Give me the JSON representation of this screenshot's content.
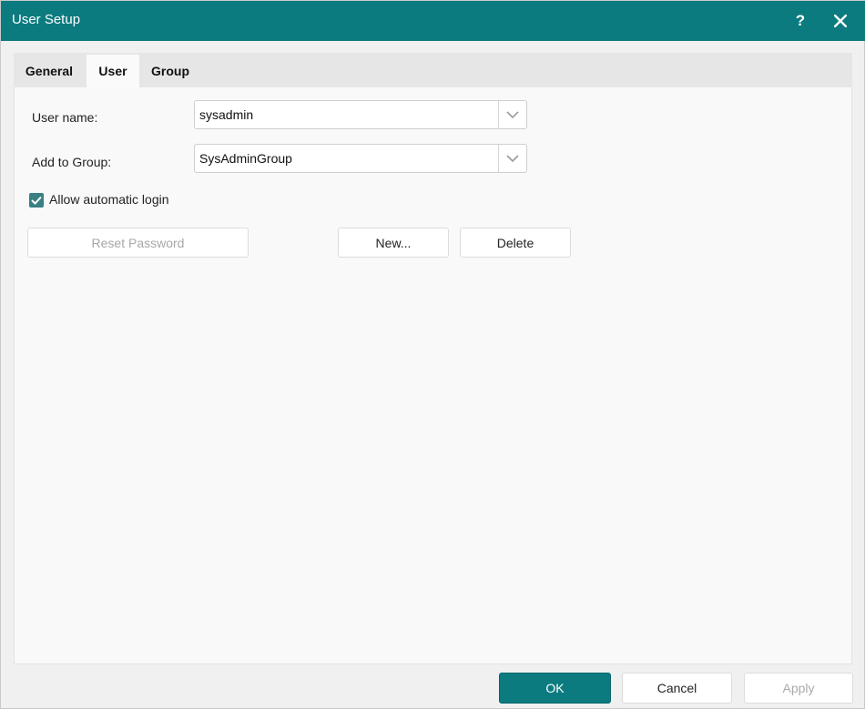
{
  "window": {
    "title": "User Setup",
    "help_icon": "question-mark-icon",
    "close_icon": "close-icon",
    "accent_color": "#0b7b7f"
  },
  "tabs": [
    {
      "label": "General",
      "active": false
    },
    {
      "label": "User",
      "active": true
    },
    {
      "label": "Group",
      "active": false
    }
  ],
  "form": {
    "user_name_label": "User name:",
    "user_name_value": "sysadmin",
    "group_label": "Add to Group:",
    "group_value": "SysAdminGroup",
    "auto_login_label": "Allow automatic login",
    "auto_login_checked": true
  },
  "actions": {
    "reset_password": "Reset Password",
    "new": "New...",
    "delete": "Delete"
  },
  "footer": {
    "ok": "OK",
    "cancel": "Cancel",
    "apply": "Apply"
  }
}
